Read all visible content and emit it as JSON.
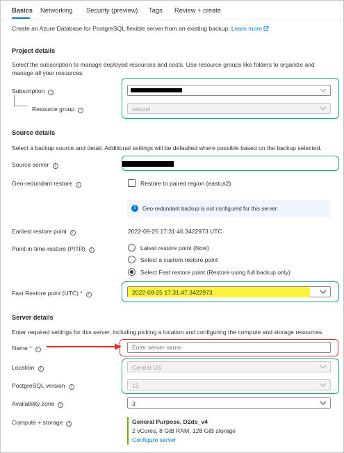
{
  "tabs": [
    {
      "label": "Basics",
      "active": true
    },
    {
      "label": "Networking",
      "active": false
    },
    {
      "label": "Security (preview)",
      "active": false
    },
    {
      "label": "Tags",
      "active": false
    },
    {
      "label": "Review + create",
      "active": false
    }
  ],
  "intro": {
    "text": "Create an Azure Database for PostgreSQL flexible server from an existing backup.",
    "link": "Learn more"
  },
  "project": {
    "heading": "Project details",
    "description": "Select the subscription to manage deployed resources and costs. Use resource groups like folders to organize and manage all your resources.",
    "subscription_label": "Subscription",
    "resource_group_label": "Resource group",
    "resource_group_value": "varund"
  },
  "source": {
    "heading": "Source details",
    "description": "Select a backup source and detail. Additional settings will be defaulted where possible based on the backup selected.",
    "source_server_label": "Source server",
    "geo_label": "Geo-redundant restore",
    "geo_checkbox_label": "Restore to paired region (eastus2)",
    "geo_info": "Geo-redundant backup is not configured for this server",
    "earliest_label": "Earliest restore point",
    "earliest_value": "2022-09-25 17:31:46.3422973 UTC",
    "pitr_label": "Point-in-time-restore (PITR)",
    "pitr_options": [
      "Latest restore point (Now)",
      "Select a custom restore point",
      "Select Fast restore point (Restore using full backup only)"
    ],
    "pitr_selected_index": 2,
    "fast_label": "Fast Restore point (UTC)",
    "fast_value": "2022-09-25 17:31:47.3422973"
  },
  "server": {
    "heading": "Server details",
    "description": "Enter required settings for this server, including picking a location and configuring the compute and storage resources.",
    "name_label": "Name",
    "name_placeholder": "Enter server name",
    "location_label": "Location",
    "location_value": "Central US",
    "version_label": "PostgreSQL version",
    "version_value": "13",
    "zone_label": "Availability zone",
    "zone_value": "3",
    "compute_label": "Compute + storage",
    "compute_tier": "General Purpose, D2ds_v4",
    "compute_specs": "2 vCores, 8 GiB RAM, 128 GiB storage",
    "compute_link": "Configure server"
  },
  "colors": {
    "accent": "#0078d4",
    "highlight_green": "#17a589",
    "highlight_red": "#e02b2b",
    "highlight_yellow": "#fbf43c",
    "required": "#a4262c"
  },
  "icons": {
    "info": "info-icon",
    "chevron": "chevron-down-icon",
    "external": "external-link-icon"
  }
}
